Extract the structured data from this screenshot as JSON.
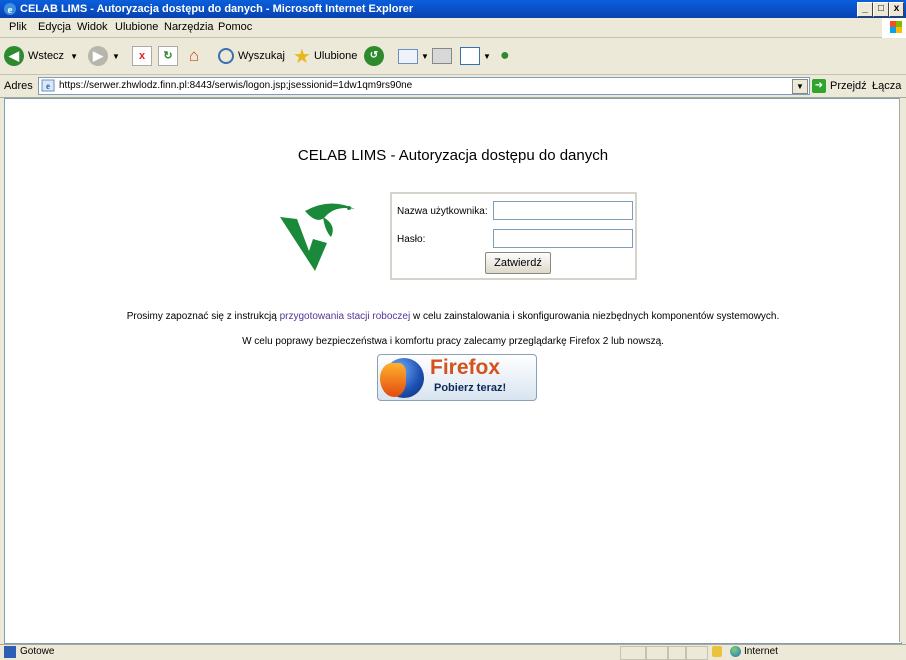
{
  "window": {
    "title": "CELAB LIMS - Autoryzacja dostępu do danych - Microsoft Internet Explorer",
    "controls": {
      "minimize": "_",
      "maximize": "□",
      "close": "x"
    }
  },
  "menu": [
    "Plik",
    "Edycja",
    "Widok",
    "Ulubione",
    "Narzędzia",
    "Pomoc"
  ],
  "toolbar": {
    "back": "Wstecz",
    "search": "Wyszukaj",
    "favorites": "Ulubione"
  },
  "address": {
    "label": "Adres",
    "url": "https://serwer.zhwlodz.finn.pl:8443/serwis/logon.jsp;jsessionid=1dw1qm9rs90ne",
    "go": "Przejdź",
    "links": "Łącza"
  },
  "page": {
    "heading": "CELAB LIMS - Autoryzacja dostępu do danych",
    "login": {
      "username_label": "Nazwa użytkownika:",
      "username_value": "",
      "password_label": "Hasło:",
      "password_value": "",
      "submit": "Zatwierdź"
    },
    "info1_pre": "Prosimy zapoznać się z instrukcją ",
    "info1_link": "przygotowania stacji roboczej",
    "info1_post": " w celu zainstalowania i skonfigurowania niezbędnych komponentów systemowych.",
    "info2": "W celu poprawy bezpieczeństwa i komfortu pracy zalecamy przeglądarkę Firefox 2 lub nowszą.",
    "firefox": {
      "name": "Firefox",
      "cta": "Pobierz teraz!"
    }
  },
  "status": {
    "text": "Gotowe",
    "zone": "Internet"
  },
  "colors": {
    "titlebar": "#0a5fdc",
    "link": "#52369a",
    "logo": "#1a8a3a"
  }
}
